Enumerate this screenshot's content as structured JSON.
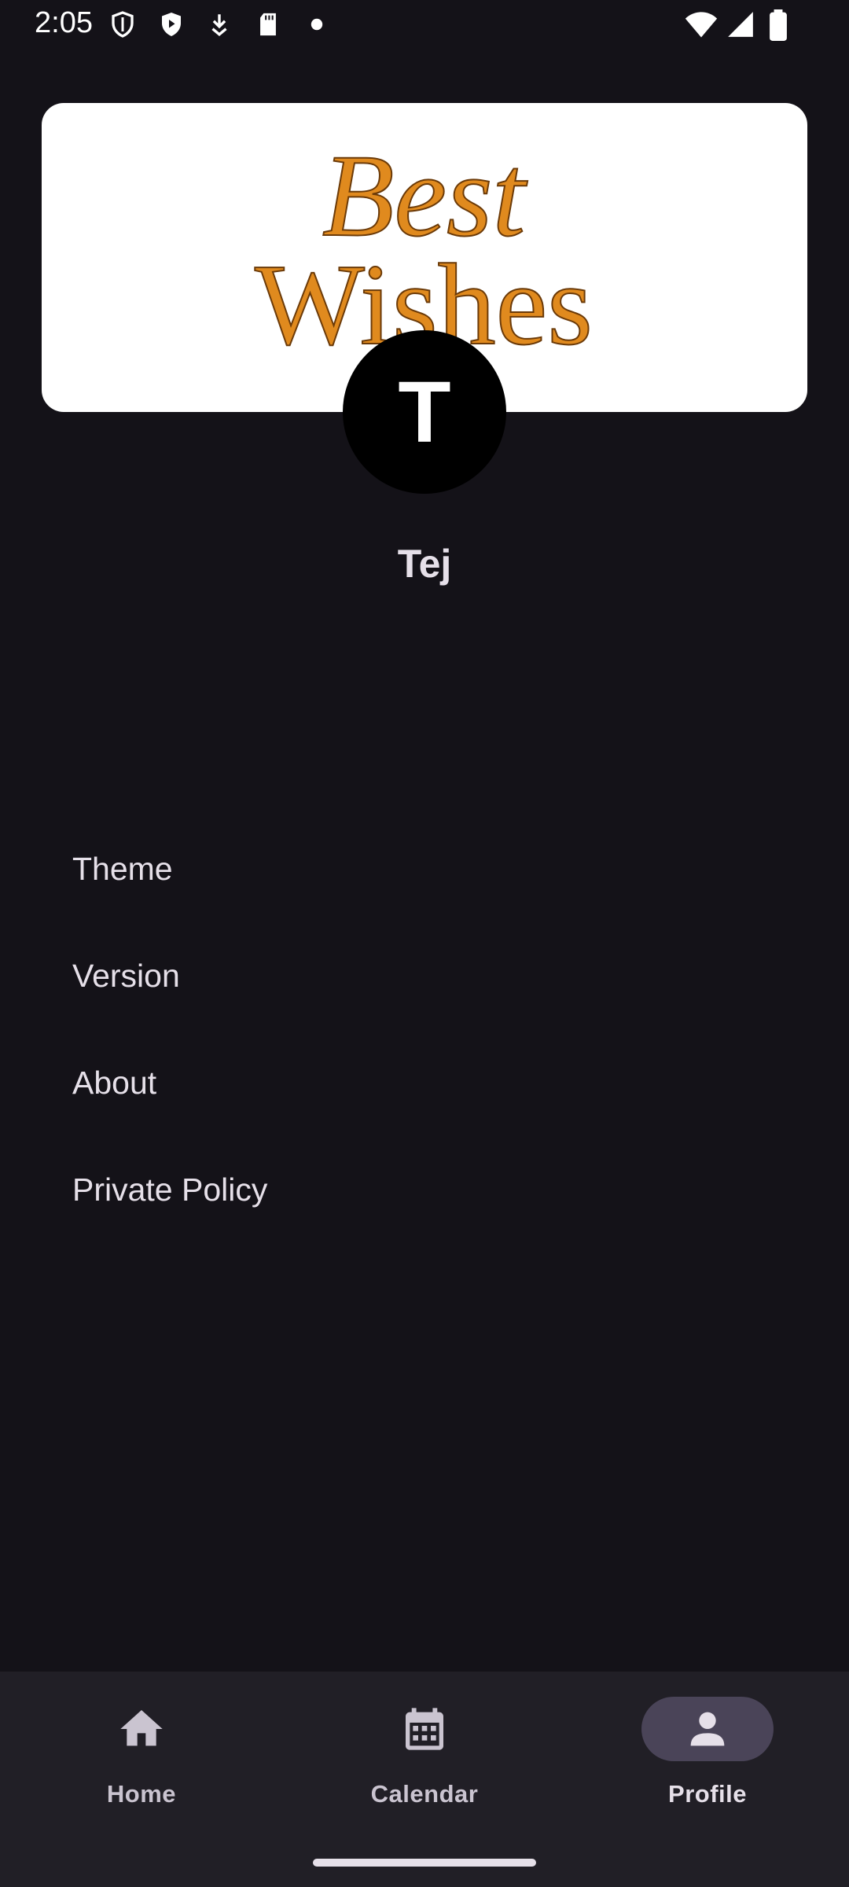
{
  "status_bar": {
    "time": "2:05",
    "icons": [
      "shield-outline-icon",
      "play-shield-icon",
      "download-icon",
      "sd-card-icon",
      "dot-icon",
      "wifi-icon",
      "signal-icon",
      "battery-icon"
    ]
  },
  "banner": {
    "logo_line1": "Best",
    "logo_line2": "Wishes",
    "logo_color": "#e08a1e"
  },
  "profile": {
    "avatar_initial": "T",
    "name": "Tej"
  },
  "menu": {
    "items": [
      {
        "label": "Theme"
      },
      {
        "label": "Version"
      },
      {
        "label": "About"
      },
      {
        "label": "Private Policy"
      }
    ]
  },
  "bottom_nav": {
    "items": [
      {
        "label": "Home",
        "icon": "home-icon",
        "active": false
      },
      {
        "label": "Calendar",
        "icon": "calendar-icon",
        "active": false
      },
      {
        "label": "Profile",
        "icon": "person-icon",
        "active": true
      }
    ]
  },
  "colors": {
    "background": "#141218",
    "nav_background": "#211f26",
    "active_pill": "#4a4458",
    "text": "#e6e0e9"
  }
}
